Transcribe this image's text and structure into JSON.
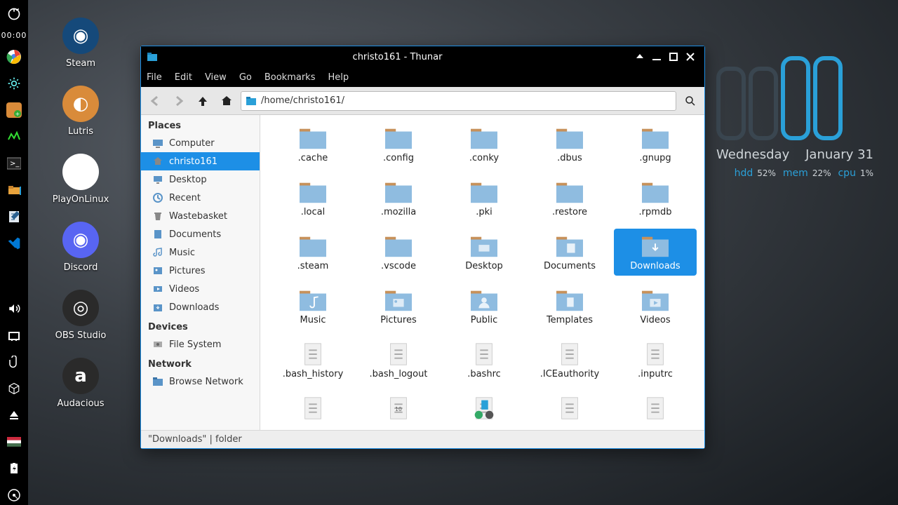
{
  "dock": {
    "clock": "00:00",
    "items_top": [
      "logout-icon",
      "chrome-icon",
      "gear-icon",
      "steam-addon-icon",
      "monitor-icon",
      "terminal-icon",
      "files-icon",
      "notes-icon",
      "vscode-icon"
    ],
    "items_bottom": [
      "volume-icon",
      "network-icon",
      "clip-icon",
      "package-icon",
      "eject-icon",
      "flag-icon",
      "battery-icon",
      "disk-icon"
    ]
  },
  "desktop_icons": [
    {
      "name": "steam",
      "label": "Steam",
      "bg": "#15497a"
    },
    {
      "name": "lutris",
      "label": "Lutris",
      "bg": "#d98b3a"
    },
    {
      "name": "playonlinux",
      "label": "PlayOnLinux",
      "bg": "#ffffff"
    },
    {
      "name": "discord",
      "label": "Discord",
      "bg": "#5865f2"
    },
    {
      "name": "obs",
      "label": "OBS Studio",
      "bg": "#2a2a2a"
    },
    {
      "name": "audacious",
      "label": "Audacious",
      "bg": "#2a2a2a"
    }
  ],
  "widget": {
    "day": "Wednesday",
    "date": "January 31",
    "stats": [
      {
        "k": "hdd",
        "v": "52%"
      },
      {
        "k": "mem",
        "v": "22%"
      },
      {
        "k": "cpu",
        "v": "1%"
      }
    ]
  },
  "window": {
    "title": "christo161 - Thunar",
    "menus": [
      "File",
      "Edit",
      "View",
      "Go",
      "Bookmarks",
      "Help"
    ],
    "location": "/home/christo161/",
    "sidebar": {
      "places_hdr": "Places",
      "devices_hdr": "Devices",
      "network_hdr": "Network",
      "places": [
        "Computer",
        "christo161",
        "Desktop",
        "Recent",
        "Wastebasket",
        "Documents",
        "Music",
        "Pictures",
        "Videos",
        "Downloads"
      ],
      "devices": [
        "File System"
      ],
      "network": [
        "Browse Network"
      ],
      "selected": "christo161"
    },
    "items": [
      {
        "n": ".cache",
        "t": "folder"
      },
      {
        "n": ".config",
        "t": "folder"
      },
      {
        "n": ".conky",
        "t": "folder"
      },
      {
        "n": ".dbus",
        "t": "folder"
      },
      {
        "n": ".gnupg",
        "t": "folder"
      },
      {
        "n": ".local",
        "t": "folder"
      },
      {
        "n": ".mozilla",
        "t": "folder"
      },
      {
        "n": ".pki",
        "t": "folder"
      },
      {
        "n": ".restore",
        "t": "folder"
      },
      {
        "n": ".rpmdb",
        "t": "folder"
      },
      {
        "n": ".steam",
        "t": "folder"
      },
      {
        "n": ".vscode",
        "t": "folder"
      },
      {
        "n": "Desktop",
        "t": "folder-desktop"
      },
      {
        "n": "Documents",
        "t": "folder-documents"
      },
      {
        "n": "Downloads",
        "t": "folder-downloads",
        "sel": true
      },
      {
        "n": "Music",
        "t": "folder-music"
      },
      {
        "n": "Pictures",
        "t": "folder-pictures"
      },
      {
        "n": "Public",
        "t": "folder-public"
      },
      {
        "n": "Templates",
        "t": "folder-templates"
      },
      {
        "n": "Videos",
        "t": "folder-videos"
      },
      {
        "n": ".bash_history",
        "t": "file"
      },
      {
        "n": ".bash_logout",
        "t": "file"
      },
      {
        "n": ".bashrc",
        "t": "file"
      },
      {
        "n": ".ICEauthority",
        "t": "file"
      },
      {
        "n": ".inputrc",
        "t": "file"
      },
      {
        "n": "",
        "t": "file"
      },
      {
        "n": "",
        "t": "file-bin"
      },
      {
        "n": "",
        "t": "file-rpm"
      },
      {
        "n": "",
        "t": "file"
      },
      {
        "n": "",
        "t": "file"
      }
    ],
    "status": "\"Downloads\"   |   folder"
  }
}
